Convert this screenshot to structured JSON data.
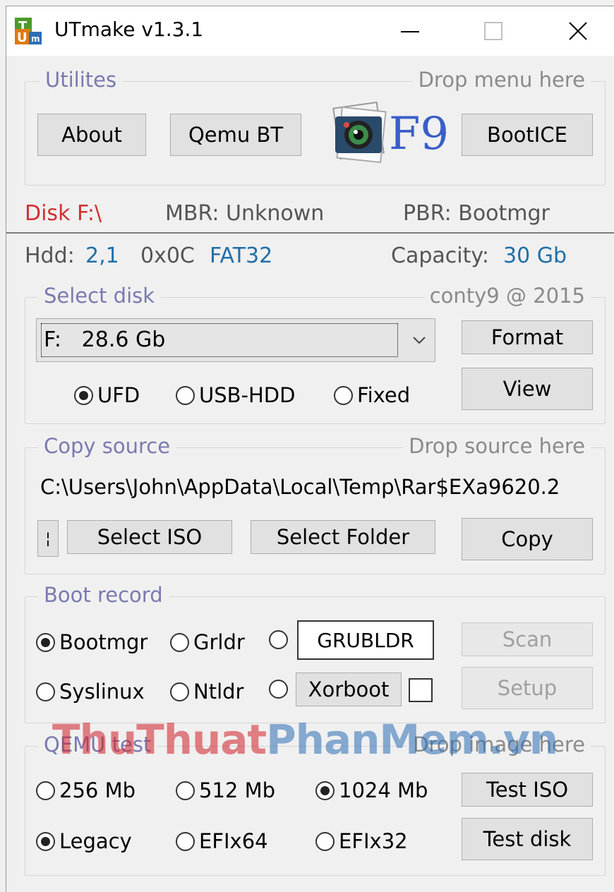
{
  "window": {
    "title": "UTmake v1.3.1",
    "icon": "ut-app-icon",
    "controls": [
      "minimize-icon",
      "maximize-icon",
      "close-icon"
    ]
  },
  "utilities": {
    "label": "Utilites",
    "drop_hint": "Drop menu here",
    "about": "About",
    "qemu_bt": "Qemu BT",
    "f9": "F9",
    "bootice": "BootICE"
  },
  "status": {
    "disk": "Disk F:\\",
    "mbr": "MBR: Unknown",
    "pbr": "PBR: Bootmgr",
    "hdd_label": "Hdd:",
    "hdd_value": "2,1",
    "fs_code": "0x0C",
    "fs_name": "FAT32",
    "capacity_label": "Capacity:",
    "capacity_value": "30 Gb"
  },
  "select_disk": {
    "label": "Select disk",
    "credit": "conty9 @ 2015",
    "selected": "F:   28.6 Gb",
    "format": "Format",
    "view": "View",
    "radios": [
      {
        "label": "UFD",
        "checked": true
      },
      {
        "label": "USB-HDD",
        "checked": false
      },
      {
        "label": "Fixed",
        "checked": false
      }
    ]
  },
  "copy_source": {
    "label": "Copy source",
    "drop_hint": "Drop source here",
    "path": "C:\\Users\\John\\AppData\\Local\\Temp\\Rar$EXa9620.2",
    "small_btn": "¦",
    "select_iso": "Select ISO",
    "select_folder": "Select Folder",
    "copy": "Copy"
  },
  "boot_record": {
    "label": "Boot record",
    "bootmgr": "Bootmgr",
    "grldr": "Grldr",
    "grubldr": "GRUBLDR",
    "syslinux": "Syslinux",
    "ntldr": "Ntldr",
    "xorboot": "Xorboot",
    "scan": "Scan",
    "setup": "Setup",
    "checked": "Bootmgr"
  },
  "qemu_test": {
    "label": "QEMU test",
    "drop_hint": "Drop image here",
    "mem_256": "256 Mb",
    "mem_512": "512 Mb",
    "mem_1024": "1024 Mb",
    "legacy": "Legacy",
    "efix64": "EFIx64",
    "efix32": "EFIx32",
    "test_iso": "Test ISO",
    "test_disk": "Test disk",
    "checked_mem": "1024 Mb",
    "checked_mode": "Legacy"
  },
  "watermark": {
    "part1": "ThuThuat",
    "part2": "PhanMem.vn"
  },
  "colors": {
    "disk_red": "#d03030",
    "value_blue": "#1f6fa8",
    "group_label": "#7a7ab0"
  }
}
